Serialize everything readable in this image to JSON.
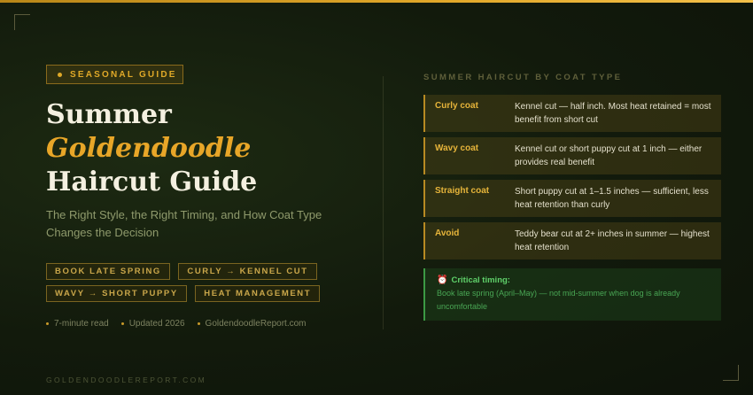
{
  "badge": "SEASONAL GUIDE",
  "title": {
    "line1": "Summer",
    "line2": "Goldendoodle",
    "line3": "Haircut Guide"
  },
  "subtitle": "The Right Style, the Right Timing, and How Coat Type Changes the Decision",
  "tags": [
    "BOOK LATE SPRING",
    "CURLY → KENNEL CUT",
    "WAVY → SHORT PUPPY",
    "HEAT MANAGEMENT"
  ],
  "meta": [
    "7-minute read",
    "Updated 2026",
    "GoldendoodleReport.com"
  ],
  "footer": "GOLDENDOODLEREPORT.COM",
  "panel": {
    "heading": "SUMMER HAIRCUT BY COAT TYPE",
    "rows": [
      {
        "label": "Curly coat",
        "desc": "Kennel cut — half inch. Most heat retained = most benefit from short cut"
      },
      {
        "label": "Wavy coat",
        "desc": "Kennel cut or short puppy cut at 1 inch — either provides real benefit"
      },
      {
        "label": "Straight coat",
        "desc": "Short puppy cut at 1–1.5 inches — sufficient, less heat retention than curly"
      },
      {
        "label": "Avoid",
        "desc": "Teddy bear cut at 2+ inches in summer — highest heat retention"
      }
    ],
    "critical": {
      "icon": "alarm-clock-icon",
      "title": "Critical timing:",
      "body": "Book late spring (April–May) — not mid-summer when dog is already uncomfortable"
    }
  },
  "colors": {
    "accent": "#e8a628",
    "critical": "#5fd06a"
  }
}
